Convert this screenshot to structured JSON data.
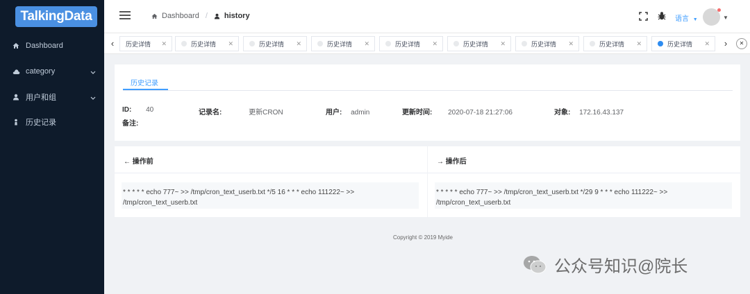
{
  "sidebar": {
    "logo": "TalkingData",
    "items": [
      {
        "label": "Dashboard",
        "icon": "home-icon"
      },
      {
        "label": "category",
        "icon": "cloud-icon",
        "expandable": true
      },
      {
        "label": "用户和组",
        "icon": "user-icon",
        "expandable": true
      },
      {
        "label": "历史记录",
        "icon": "person-icon"
      }
    ]
  },
  "navbar": {
    "breadcrumb": [
      {
        "label": "Dashboard",
        "icon": "home-icon"
      },
      {
        "label": "history",
        "icon": "user-icon"
      }
    ],
    "language_label": "语言"
  },
  "tags": {
    "items": [
      {
        "label": "历史详情",
        "active": false
      },
      {
        "label": "历史详情",
        "active": false
      },
      {
        "label": "历史详情",
        "active": false
      },
      {
        "label": "历史详情",
        "active": false
      },
      {
        "label": "历史详情",
        "active": false
      },
      {
        "label": "历史详情",
        "active": false
      },
      {
        "label": "历史详情",
        "active": false
      },
      {
        "label": "历史详情",
        "active": false
      },
      {
        "label": "历史详情",
        "active": true
      }
    ]
  },
  "record": {
    "tab_label": "历史记录",
    "id_label": "ID:",
    "id_value": "40",
    "name_label": "记录名:",
    "name_value": "更新CRON",
    "user_label": "用户:",
    "user_value": "admin",
    "time_label": "更新时间:",
    "time_value": "2020-07-18 21:27:06",
    "target_label": "对象:",
    "target_value": "172.16.43.137",
    "note_label": "备注:"
  },
  "before": {
    "title": "操作前",
    "line1": "* * * * * echo 777~ >> /tmp/cron_text_userb.txt */5 16 * * * echo 111222~ >>",
    "line2": "/tmp/cron_text_userb.txt"
  },
  "after": {
    "title": "操作后",
    "line1": "* * * * * echo 777~ >> /tmp/cron_text_userb.txt */29 9 * * * echo 111222~ >>",
    "line2": "/tmp/cron_text_userb.txt"
  },
  "footer": "Copyright © 2019 Myide",
  "watermark": "公众号知识@院长",
  "colors": {
    "accent": "#409eff",
    "sidebar_bg": "#0e1b2b",
    "logo_bg": "#4a90e2"
  }
}
